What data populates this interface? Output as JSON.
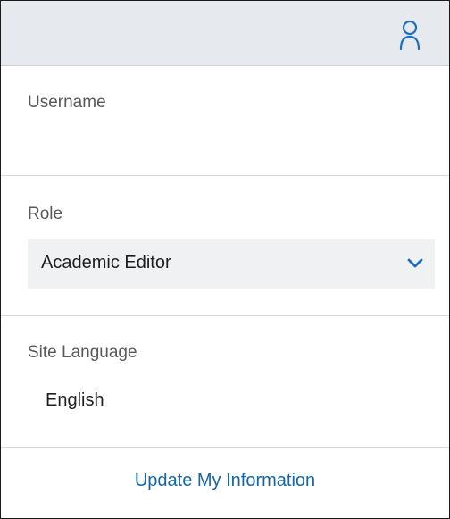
{
  "header": {
    "user_icon": "user-icon",
    "accent_color": "#1a6fc0",
    "background": "#e6e9ed"
  },
  "username": {
    "label": "Username",
    "value": ""
  },
  "role": {
    "label": "Role",
    "selected": "Academic Editor",
    "chevron_icon": "chevron-down-icon"
  },
  "site_language": {
    "label": "Site Language",
    "selected": "English"
  },
  "actions": {
    "update_label": "Update My Information",
    "link_color": "#1565a8"
  }
}
